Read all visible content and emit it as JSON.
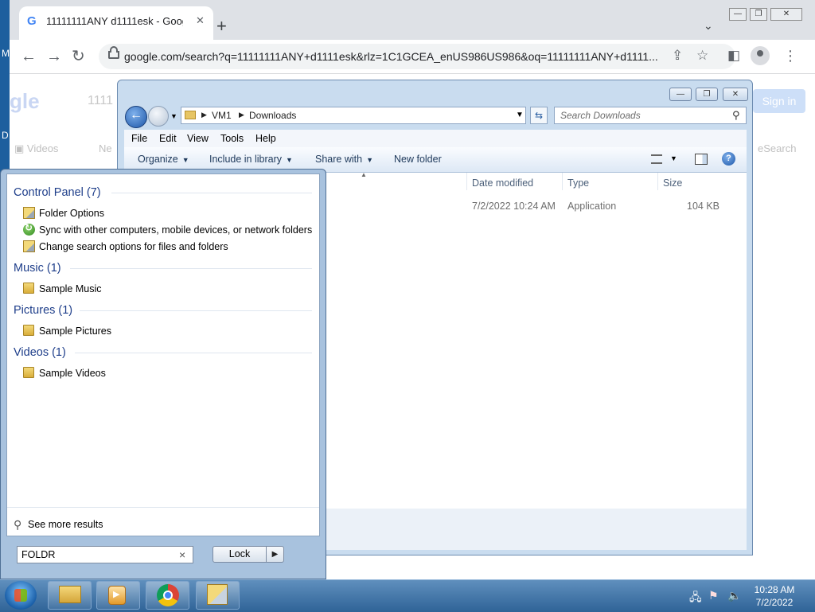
{
  "desktop": {
    "edge_letters": [
      "M",
      "D"
    ]
  },
  "chrome": {
    "tab": {
      "title": "11111111ANY d1111esk - Goog"
    },
    "url": "google.com/search?q=11111111ANY+d1111esk&rlz=1C1GCEA_enUS986US986&oq=11111111ANY+d1111...",
    "background": {
      "logo": "gle",
      "query": "1111",
      "videos_tab": "Videos",
      "news_tab": "Ne",
      "signin": "Sign in",
      "safesearch": "eSearch"
    },
    "window_controls": [
      "—",
      "❐",
      "✕"
    ]
  },
  "explorer": {
    "window_controls": [
      "—",
      "❐",
      "✕"
    ],
    "address": {
      "segments": [
        "VM1",
        "Downloads"
      ]
    },
    "search_placeholder": "Search Downloads",
    "menu": [
      "File",
      "Edit",
      "View",
      "Tools",
      "Help"
    ],
    "commands": {
      "organize": "Organize",
      "include_library": "Include in library",
      "share_with": "Share with",
      "new_folder": "New folder"
    },
    "columns": {
      "date": "Date modified",
      "type": "Type",
      "size": "Size"
    },
    "files": [
      {
        "date": "7/2/2022 10:24 AM",
        "type": "Application",
        "size": "104 KB"
      }
    ]
  },
  "start_menu": {
    "groups": [
      {
        "title": "Control Panel (7)",
        "items": [
          {
            "label": "Folder Options",
            "icon": "control-panel-icon"
          },
          {
            "label": "Sync with other computers, mobile devices, or network folders",
            "icon": "sync-icon"
          },
          {
            "label": "Change search options for files and folders",
            "icon": "control-panel-icon"
          }
        ]
      },
      {
        "title": "Music (1)",
        "items": [
          {
            "label": "Sample Music",
            "icon": "folder-icon"
          }
        ]
      },
      {
        "title": "Pictures (1)",
        "items": [
          {
            "label": "Sample Pictures",
            "icon": "folder-icon"
          }
        ]
      },
      {
        "title": "Videos (1)",
        "items": [
          {
            "label": "Sample Videos",
            "icon": "folder-icon"
          }
        ]
      }
    ],
    "see_more": "See more results",
    "search_value": "FOLDR",
    "lock_label": "Lock"
  },
  "taskbar": {
    "time": "10:28 AM",
    "date": "7/2/2022"
  }
}
